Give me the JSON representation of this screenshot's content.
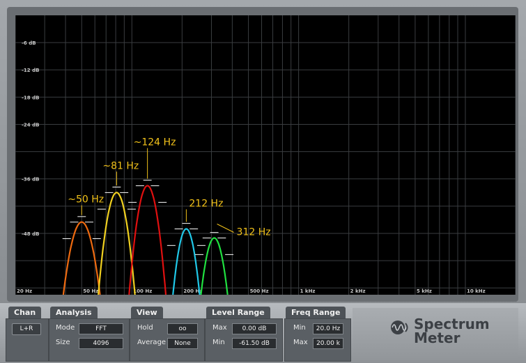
{
  "app": {
    "product_line1": "Spectrum",
    "product_line2": "Meter"
  },
  "sections": {
    "chan": {
      "title": "Chan",
      "button": "L+R"
    },
    "analysis": {
      "title": "Analysis",
      "mode_label": "Mode",
      "mode_value": "FFT",
      "size_label": "Size",
      "size_value": "4096"
    },
    "view": {
      "title": "View",
      "hold_label": "Hold",
      "hold_value": "oo",
      "average_label": "Average",
      "average_value": "None"
    },
    "level_range": {
      "title": "Level Range",
      "max_label": "Max",
      "max_value": "0.00 dB",
      "min_label": "Min",
      "min_value": "-61.50 dB"
    },
    "freq_range": {
      "title": "Freq Range",
      "min_label": "Min",
      "min_value": "20.0 Hz",
      "max_label": "Max",
      "max_value": "20.00 k"
    }
  },
  "chart_data": {
    "type": "line",
    "x_scale": "log",
    "xlim": [
      20,
      20000
    ],
    "ylim": [
      -61.5,
      0
    ],
    "grid": true,
    "y_ticks": [
      {
        "value": -6,
        "label": "-6 dB"
      },
      {
        "value": -12,
        "label": "-12 dB"
      },
      {
        "value": -18,
        "label": "-18 dB"
      },
      {
        "value": -24,
        "label": "-24 dB"
      },
      {
        "value": -36,
        "label": "-36 dB"
      },
      {
        "value": -48,
        "label": "-48 dB"
      }
    ],
    "x_ticks": [
      {
        "value": 20,
        "label": "20 Hz"
      },
      {
        "value": 50,
        "label": "50 Hz"
      },
      {
        "value": 100,
        "label": "100 Hz"
      },
      {
        "value": 200,
        "label": "200 Hz"
      },
      {
        "value": 500,
        "label": "500 Hz"
      },
      {
        "value": 1000,
        "label": "1 kHz"
      },
      {
        "value": 2000,
        "label": "2 kHz"
      },
      {
        "value": 5000,
        "label": "5 kHz"
      },
      {
        "value": 10000,
        "label": "10 kHz"
      }
    ],
    "peaks": [
      {
        "freq": 50,
        "level": -45.5,
        "color": "#ee6a10",
        "annotation": "~50 Hz"
      },
      {
        "freq": 81,
        "level": -39,
        "color": "#f0d020",
        "annotation": "~81 Hz"
      },
      {
        "freq": 124,
        "level": -37.5,
        "color": "#e01010",
        "annotation": "~124 Hz"
      },
      {
        "freq": 212,
        "level": -47,
        "color": "#20c8e8",
        "annotation": "212 Hz"
      },
      {
        "freq": 312,
        "level": -49,
        "color": "#20e040",
        "annotation": "312 Hz"
      }
    ],
    "annotation_color": "#f2c21a"
  }
}
